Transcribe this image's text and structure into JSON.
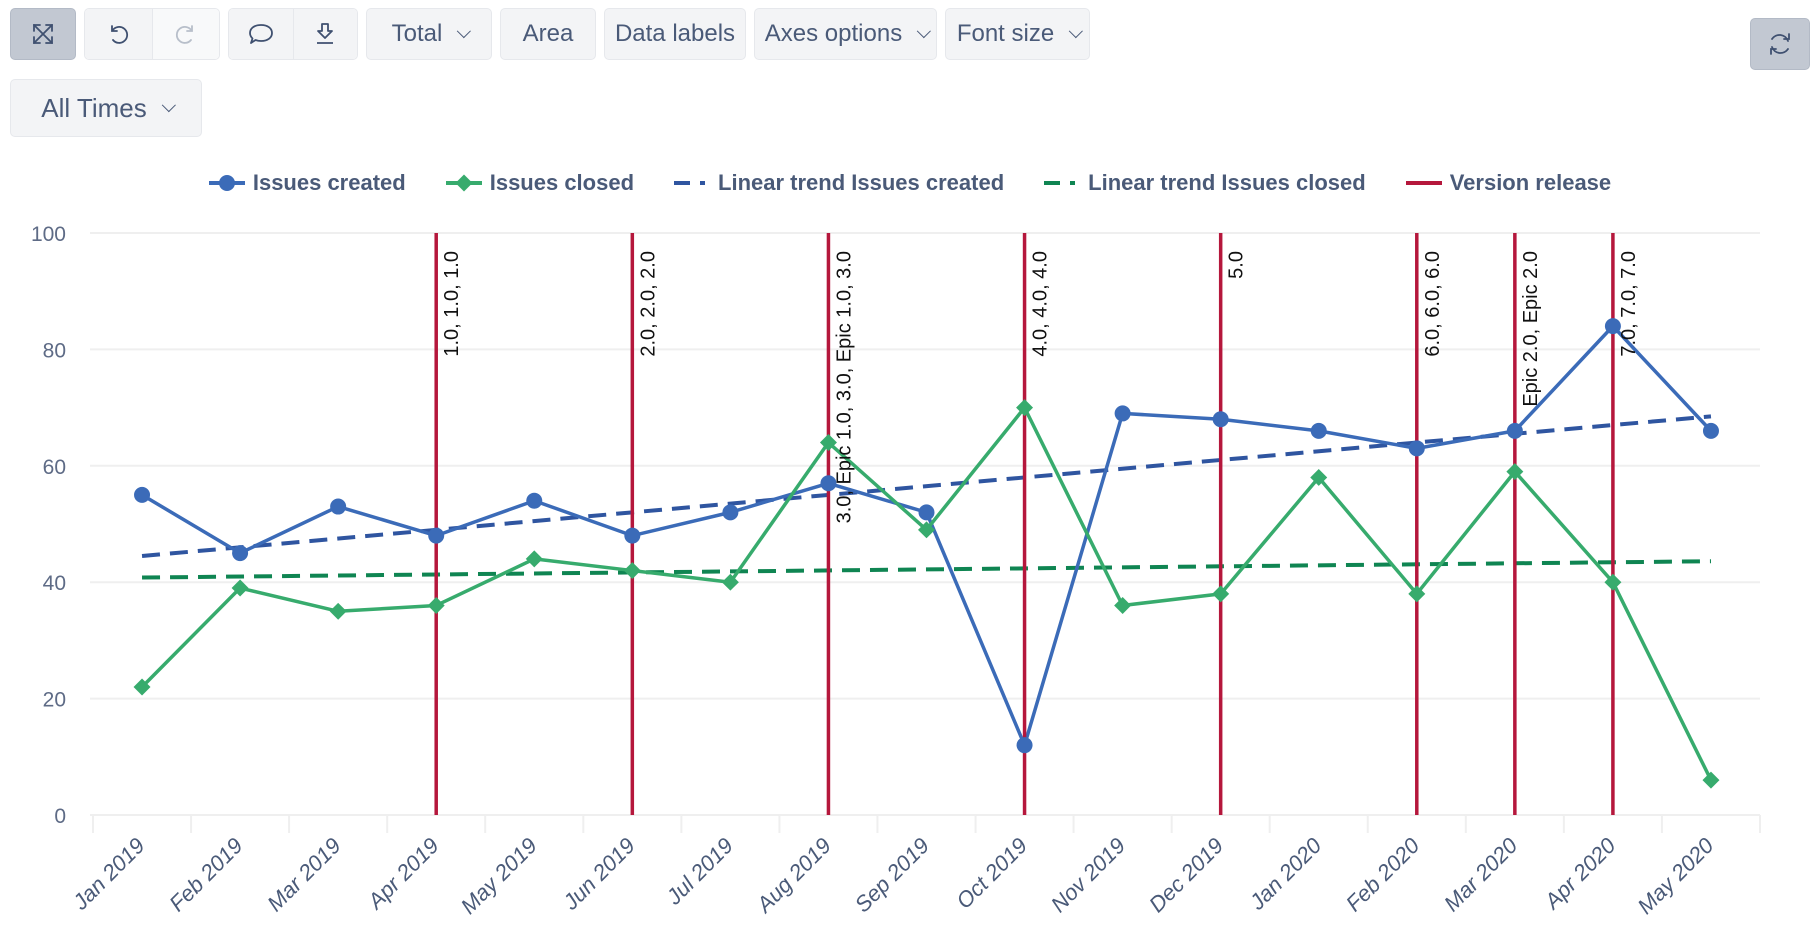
{
  "toolbar": {
    "fullscreen_icon": "expand-arrows-icon",
    "undo_icon": "undo-icon",
    "redo_icon": "redo-icon",
    "comment_icon": "comment-bubble-icon",
    "download_icon": "download-icon",
    "total_label": "Total",
    "area_label": "Area",
    "data_labels_label": "Data labels",
    "axes_options_label": "Axes options",
    "font_size_label": "Font size",
    "refresh_icon": "refresh-icon",
    "time_filter_label": "All Times"
  },
  "colors": {
    "issues_created": "#3b6bb8",
    "issues_closed": "#37ab6d",
    "trend_created": "#2f55a0",
    "trend_closed": "#0f8552",
    "version_release": "#b5173c",
    "grid": "#efefef",
    "axis_text": "#4a5a78"
  },
  "chart_data": {
    "type": "line",
    "title": "",
    "xlabel": "",
    "ylabel": "",
    "ylim": [
      0,
      100
    ],
    "yticks": [
      0,
      20,
      40,
      60,
      80,
      100
    ],
    "grid": true,
    "legend_position": "top-center",
    "categories": [
      "Jan 2019",
      "Feb 2019",
      "Mar 2019",
      "Apr 2019",
      "May 2019",
      "Jun 2019",
      "Jul 2019",
      "Aug 2019",
      "Sep 2019",
      "Oct 2019",
      "Nov 2019",
      "Dec 2019",
      "Jan 2020",
      "Feb 2020",
      "Mar 2020",
      "Apr 2020",
      "May 2020"
    ],
    "series": [
      {
        "name": "Issues created",
        "kind": "line-marker-circle",
        "color_key": "issues_created",
        "values": [
          55,
          45,
          53,
          48,
          54,
          48,
          52,
          57,
          52,
          12,
          69,
          68,
          66,
          63,
          66,
          84,
          66
        ]
      },
      {
        "name": "Issues closed",
        "kind": "line-marker-diamond",
        "color_key": "issues_closed",
        "values": [
          22,
          39,
          35,
          36,
          44,
          42,
          40,
          64,
          49,
          70,
          36,
          38,
          58,
          38,
          59,
          40,
          6
        ]
      },
      {
        "name": "Linear trend Issues created",
        "kind": "dashed",
        "color_key": "trend_created",
        "start": 44.5,
        "end": 68.5
      },
      {
        "name": "Linear trend Issues closed",
        "kind": "dashed",
        "color_key": "trend_closed",
        "start": 40.8,
        "end": 43.6
      }
    ],
    "legend": [
      {
        "label": "Issues created",
        "symbol": "circle",
        "color_key": "issues_created"
      },
      {
        "label": "Issues closed",
        "symbol": "diamond",
        "color_key": "issues_closed"
      },
      {
        "label": "Linear trend Issues created",
        "symbol": "dash",
        "color_key": "trend_created"
      },
      {
        "label": "Linear trend Issues closed",
        "symbol": "dash",
        "color_key": "trend_closed"
      },
      {
        "label": "Version release",
        "symbol": "line",
        "color_key": "version_release"
      }
    ],
    "version_releases": [
      {
        "category_index": 3,
        "label": "1.0, 1.0, 1.0"
      },
      {
        "category_index": 5,
        "label": "2.0, 2.0, 2.0"
      },
      {
        "category_index": 7,
        "label": "3.0, Epic 1.0, 3.0, Epic 1.0, 3.0"
      },
      {
        "category_index": 9,
        "label": "4.0, 4.0, 4.0"
      },
      {
        "category_index": 11,
        "label": "5.0"
      },
      {
        "category_index": 13,
        "label": "6.0, 6.0, 6.0"
      },
      {
        "category_index": 14,
        "label": "Epic 2.0, Epic 2.0"
      },
      {
        "category_index": 15,
        "label": "7.0, 7.0, 7.0"
      }
    ]
  }
}
